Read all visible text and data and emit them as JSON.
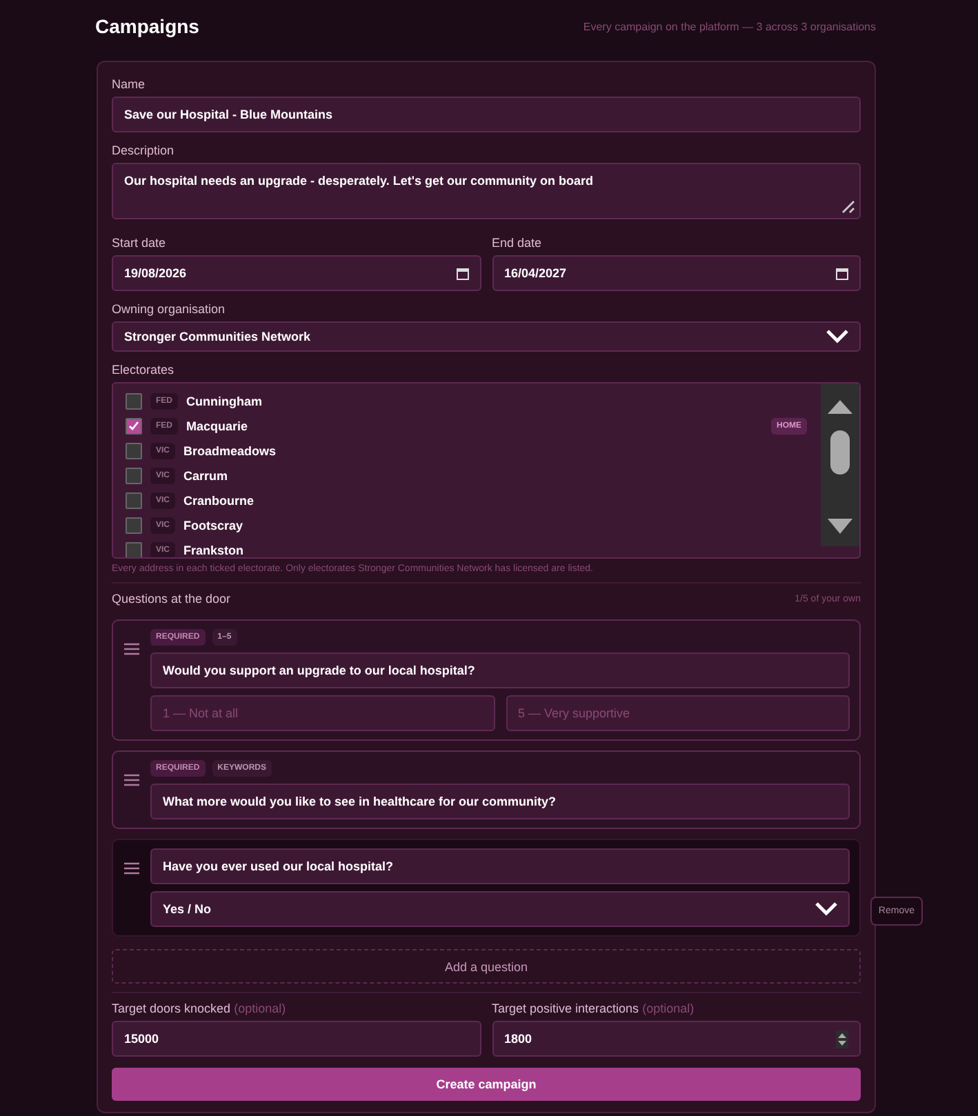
{
  "header": {
    "title": "Campaigns",
    "subtitle": "Every campaign on the platform — 3 across 3 organisations"
  },
  "name": {
    "label": "Name",
    "value": "Save our Hospital - Blue Mountains"
  },
  "description": {
    "label": "Description",
    "value": "Our hospital needs an upgrade - desperately. Let's get our community on board"
  },
  "start_date": {
    "label": "Start date",
    "value": "19/08/2026"
  },
  "end_date": {
    "label": "End date",
    "value": "16/04/2027"
  },
  "organisation": {
    "label": "Owning organisation",
    "value": "Stronger Communities Network"
  },
  "electorates": {
    "label": "Electorates",
    "hint": "Every address in each ticked electorate. Only electorates Stronger Communities Network has licensed are listed.",
    "items": [
      {
        "level_tag": "FED",
        "name": "Cunningham",
        "checked": false
      },
      {
        "level_tag": "FED",
        "name": "Macquarie",
        "checked": true,
        "badge": "HOME"
      },
      {
        "level_tag": "VIC",
        "name": "Broadmeadows",
        "checked": false
      },
      {
        "level_tag": "VIC",
        "name": "Carrum",
        "checked": false
      },
      {
        "level_tag": "VIC",
        "name": "Cranbourne",
        "checked": false
      },
      {
        "level_tag": "VIC",
        "name": "Footscray",
        "checked": false
      },
      {
        "level_tag": "VIC",
        "name": "Frankston",
        "checked": false
      }
    ]
  },
  "questions": {
    "title": "Questions at the door",
    "count": "1/5 of your own",
    "add_label": "Add a question",
    "items": [
      {
        "kind": "scale",
        "selected": false,
        "tags": [
          "REQUIRED",
          "1–5"
        ],
        "text": "Would you support an upgrade to our local hospital?",
        "low_placeholder": "1 — Not at all",
        "high_placeholder": "5 — Very supportive"
      },
      {
        "kind": "text",
        "selected": false,
        "tags": [
          "REQUIRED",
          "KEYWORDS"
        ],
        "text": "What more would you like to see in healthcare for our community?"
      },
      {
        "kind": "choice",
        "selected": true,
        "text": "Have you ever used our local hospital?",
        "answer_type": "Yes / No",
        "remove_label": "Remove"
      }
    ]
  },
  "targets": [
    {
      "label": "Target doors knocked",
      "hint": "(optional)",
      "value": "15000",
      "spinner": false
    },
    {
      "label": "Target positive interactions",
      "hint": "(optional)",
      "value": "1800",
      "spinner": true
    }
  ],
  "submit": "Create campaign"
}
